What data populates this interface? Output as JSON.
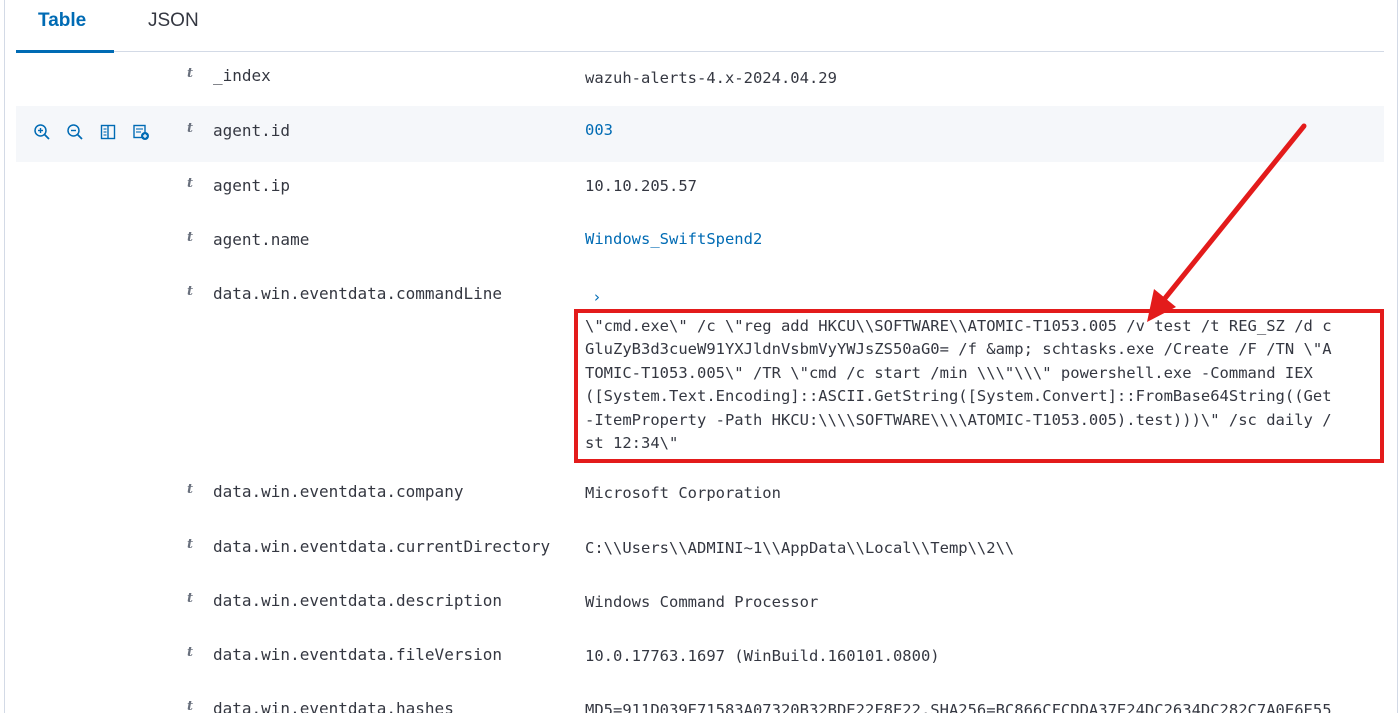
{
  "tabs": {
    "table": "Table",
    "json": "JSON"
  },
  "icons": {
    "zoom_in": "zoom-in-icon",
    "zoom_out": "zoom-out-icon",
    "toggle_column": "toggle-column-icon",
    "filter_exists": "filter-exists-icon"
  },
  "colors": {
    "accent": "#006bb4",
    "annotation": "#e31b1b"
  },
  "field_type_glyph": "t",
  "fields": [
    {
      "name": "_index",
      "value": "wazuh-alerts-4.x-2024.04.29"
    },
    {
      "name": "agent.id",
      "value": "003"
    },
    {
      "name": "agent.ip",
      "value": "10.10.205.57"
    },
    {
      "name": "agent.name",
      "value": "Windows_SwiftSpend2"
    },
    {
      "name": "data.win.eventdata.commandLine",
      "value_lines": [
        "\\\"cmd.exe\\\" /c \\\"reg add HKCU\\\\SOFTWARE\\\\ATOMIC-T1053.005 /v test /t REG_SZ /d c",
        "GluZyB3d3cueW91YXJldnVsbmVyYWJsZS50aG0= /f &amp; schtasks.exe /Create /F /TN \\\"A",
        "TOMIC-T1053.005\\\" /TR \\\"cmd /c start /min \\\\\\\"\\\\\\\" powershell.exe -Command IEX",
        "([System.Text.Encoding]::ASCII.GetString([System.Convert]::FromBase64String((Get",
        "-ItemProperty -Path HKCU:\\\\\\\\SOFTWARE\\\\\\\\ATOMIC-T1053.005).test)))\\\" /sc daily /",
        "st 12:34\\\""
      ]
    },
    {
      "name": "data.win.eventdata.company",
      "value": "Microsoft Corporation"
    },
    {
      "name": "data.win.eventdata.currentDirectory",
      "value": "C:\\\\Users\\\\ADMINI~1\\\\AppData\\\\Local\\\\Temp\\\\2\\\\"
    },
    {
      "name": "data.win.eventdata.description",
      "value": "Windows Command Processor"
    },
    {
      "name": "data.win.eventdata.fileVersion",
      "value": "10.0.17763.1697 (WinBuild.160101.0800)"
    },
    {
      "name": "data.win.eventdata.hashes",
      "value": "MD5=911D039E71583A07320B32BDE22F8E22,SHA256=BC866CFCDDA37E24DC2634DC282C7A0E6E55"
    }
  ]
}
